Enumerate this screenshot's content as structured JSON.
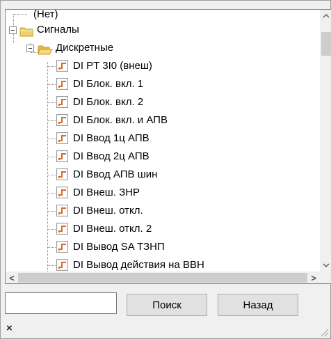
{
  "tree": {
    "none_item": "(Нет)",
    "signals_folder": "Сигналы",
    "discrete_folder": "Дискретные",
    "items": [
      "DI PT 3I0 (внеш)",
      "DI Блок. вкл. 1",
      "DI Блок. вкл. 2",
      "DI Блок. вкл. и АПВ",
      "DI Ввод 1ц АПВ",
      "DI Ввод 2ц АПВ",
      "DI Ввод АПВ шин",
      "DI Внеш. ЗНР",
      "DI Внеш. откл.",
      "DI Внеш. откл. 2",
      "DI Вывод SA ТЗНП",
      "DI Вывод действия на ВВН"
    ]
  },
  "search": {
    "value": "",
    "button_label": "Поиск"
  },
  "back_button_label": "Назад",
  "close_glyph": "×",
  "scroll": {
    "up_glyph": "▲",
    "down_glyph": "▼",
    "left_glyph": "<",
    "right_glyph": ">"
  },
  "colors": {
    "folder": "#e9c24f",
    "folder_dark": "#c79a22",
    "signal_step": "#d86a2a"
  }
}
